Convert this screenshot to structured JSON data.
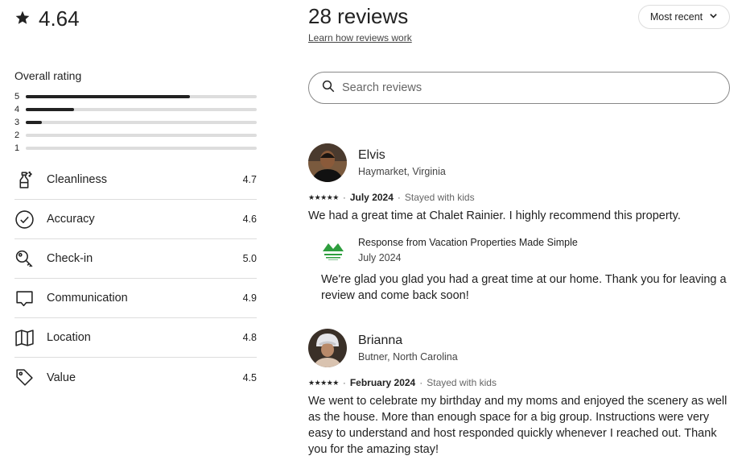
{
  "summary": {
    "score": "4.64",
    "overall_label": "Overall rating",
    "distribution": [
      {
        "label": "5",
        "fraction": 0.71
      },
      {
        "label": "4",
        "fraction": 0.21
      },
      {
        "label": "3",
        "fraction": 0.07
      },
      {
        "label": "2",
        "fraction": 0.0
      },
      {
        "label": "1",
        "fraction": 0.0
      }
    ]
  },
  "categories": [
    {
      "label": "Cleanliness",
      "value": "4.7",
      "icon": "spray-bottle-icon"
    },
    {
      "label": "Accuracy",
      "value": "4.6",
      "icon": "check-circle-icon"
    },
    {
      "label": "Check-in",
      "value": "5.0",
      "icon": "key-icon"
    },
    {
      "label": "Communication",
      "value": "4.9",
      "icon": "chat-bubble-icon"
    },
    {
      "label": "Location",
      "value": "4.8",
      "icon": "map-icon"
    },
    {
      "label": "Value",
      "value": "4.5",
      "icon": "tag-icon"
    }
  ],
  "reviews_header": {
    "title": "28 reviews",
    "learn_link": "Learn how reviews work",
    "sort_label": "Most recent",
    "search_placeholder": "Search reviews"
  },
  "reviews": [
    {
      "name": "Elvis",
      "location": "Haymarket, Virginia",
      "stars": "★★★★★",
      "date": "July 2024",
      "trip": "Stayed with kids",
      "text": "We had a great time at Chalet Rainier. I highly recommend this property.",
      "response": {
        "title": "Response from Vacation Properties Made Simple",
        "date": "July 2024",
        "text": "We're glad you glad you had a great time at our home. Thank you for leaving a review and come back soon!"
      }
    },
    {
      "name": "Brianna",
      "location": "Butner, North Carolina",
      "stars": "★★★★★",
      "date": "February 2024",
      "trip": "Stayed with kids",
      "text": "We went to celebrate my birthday and my moms and enjoyed the scenery as well as the house. More than enough space for a big group. Instructions were very easy to understand and host responded quickly whenever I reached out. Thank you for the amazing stay!"
    }
  ],
  "colors": {
    "text": "#222222",
    "muted": "#444444",
    "divider": "#dddddd",
    "logo_green": "#2e9e3e"
  }
}
